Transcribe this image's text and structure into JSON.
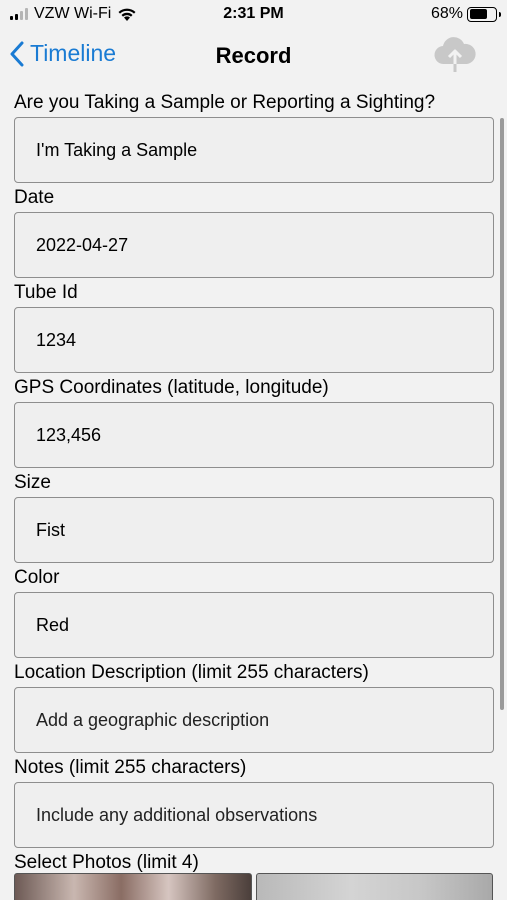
{
  "status_bar": {
    "carrier": "VZW Wi-Fi",
    "time": "2:31 PM",
    "battery_percent": "68%",
    "battery_level": 0.68,
    "signal_bars_active": 2,
    "signal_bars_total": 4,
    "icons": [
      "cellular-signal-icon",
      "wifi-icon",
      "battery-icon"
    ]
  },
  "nav": {
    "back_label": "Timeline",
    "title": "Record",
    "back_icon": "chevron-left-icon",
    "upload_icon": "cloud-upload-icon",
    "accent_color": "#1a7bd3"
  },
  "form": {
    "fields": [
      {
        "label": "Are you Taking a Sample or Reporting a Sighting?",
        "value": "I'm Taking a Sample"
      },
      {
        "label": "Date",
        "value": "2022-04-27"
      },
      {
        "label": "Tube Id",
        "value": "1234"
      },
      {
        "label": "GPS Coordinates (latitude, longitude)",
        "value": "123,456"
      },
      {
        "label": "Size",
        "value": "Fist"
      },
      {
        "label": "Color",
        "value": "Red"
      },
      {
        "label": "Location Description (limit 255 characters)",
        "placeholder": "Add a geographic description"
      },
      {
        "label": "Notes (limit 255 characters)",
        "placeholder": "Include any additional observations"
      }
    ],
    "photos_label": "Select Photos (limit 4)"
  }
}
